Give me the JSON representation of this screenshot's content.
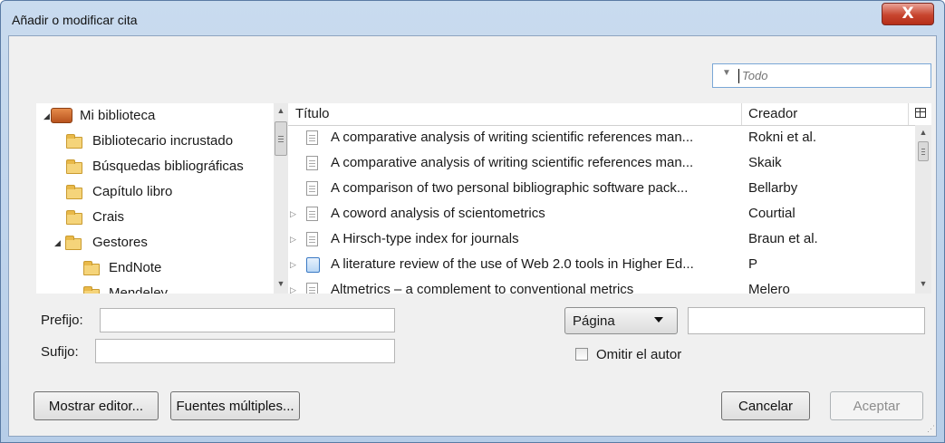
{
  "window": {
    "title": "Añadir o modificar cita",
    "close_label": "X"
  },
  "search": {
    "placeholder": "Todo",
    "mode_icon": "dropdown-arrow-icon"
  },
  "library": {
    "root": "Mi biblioteca",
    "folders": [
      {
        "label": "Bibliotecario incrustado"
      },
      {
        "label": "Búsquedas bibliográficas"
      },
      {
        "label": "Capítulo libro"
      },
      {
        "label": "Crais"
      },
      {
        "label": "Gestores"
      },
      {
        "label": "EndNote"
      },
      {
        "label": "Mendeley"
      }
    ]
  },
  "items": {
    "columns": {
      "title": "Título",
      "creator": "Creador"
    },
    "rows": [
      {
        "title": "A comparative analysis of writing scientific references man...",
        "creator": "Rokni et al."
      },
      {
        "title": "A comparative analysis of writing scientific references man...",
        "creator": "Skaik"
      },
      {
        "title": "A comparison of two personal bibliographic software pack...",
        "creator": "Bellarby"
      },
      {
        "title": "A coword analysis of scientometrics",
        "creator": "Courtial"
      },
      {
        "title": "A Hirsch-type index for journals",
        "creator": "Braun et al."
      },
      {
        "title": "A literature review of the use of Web 2.0 tools in Higher Ed...",
        "creator": "P"
      },
      {
        "title": "Altmetrics – a complement to conventional metrics",
        "creator": "Melero"
      }
    ]
  },
  "form": {
    "prefix_label": "Prefijo:",
    "suffix_label": "Sufijo:",
    "locator_selected": "Página",
    "omit_author_label": "Omitir el autor",
    "omit_author_checked": false
  },
  "buttons": {
    "show_editor": "Mostrar editor...",
    "multiple_sources": "Fuentes múltiples...",
    "cancel": "Cancelar",
    "accept": "Aceptar"
  },
  "colors": {
    "title_gradient": "#b6cde8",
    "close_red": "#c8452f",
    "focus_border": "#7aa7d6"
  }
}
